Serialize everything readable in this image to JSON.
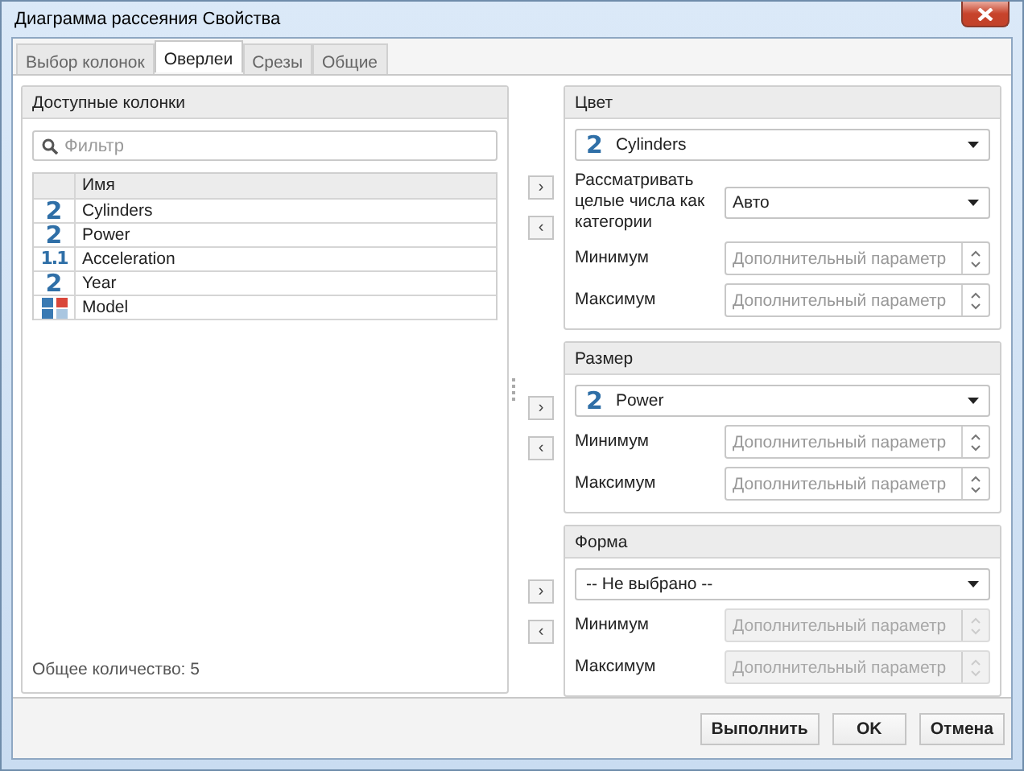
{
  "window": {
    "title": "Диаграмма рассеяния Свойства"
  },
  "tabs": [
    {
      "label": "Выбор колонок",
      "selected": false
    },
    {
      "label": "Оверлеи",
      "selected": true
    },
    {
      "label": "Срезы",
      "selected": false
    },
    {
      "label": "Общие",
      "selected": false
    }
  ],
  "columns_panel": {
    "title": "Доступные колонки",
    "search": {
      "placeholder": "Фильтр"
    },
    "table": {
      "columns": [
        "Имя"
      ],
      "rows": [
        {
          "kind": "integer",
          "icon": "2",
          "name": "Cylinders"
        },
        {
          "kind": "integer",
          "icon": "2",
          "name": "Power"
        },
        {
          "kind": "real",
          "icon": "1.1",
          "name": "Acceleration"
        },
        {
          "kind": "integer",
          "icon": "2",
          "name": "Year"
        },
        {
          "kind": "categorical",
          "name": "Model"
        }
      ]
    },
    "total": "Общее количество: 5"
  },
  "sections": [
    {
      "title": "Цвет",
      "move_buttons": [
        "›",
        "‹"
      ],
      "selector": {
        "kind": "integer",
        "icon": "2",
        "value": "Cylinders"
      },
      "option": {
        "label": "Рассматривать целые числа как категории",
        "value": "Авто"
      },
      "fields": [
        {
          "label": "Минимум",
          "placeholder": "Дополнительный параметр",
          "disabled": false
        },
        {
          "label": "Максимум",
          "placeholder": "Дополнительный параметр",
          "disabled": false
        }
      ]
    },
    {
      "title": "Размер",
      "move_buttons": [
        "›",
        "‹"
      ],
      "selector": {
        "kind": "integer",
        "icon": "2",
        "value": "Power"
      },
      "fields": [
        {
          "label": "Минимум",
          "placeholder": "Дополнительный параметр",
          "disabled": false
        },
        {
          "label": "Максимум",
          "placeholder": "Дополнительный параметр",
          "disabled": false
        }
      ]
    },
    {
      "title": "Форма",
      "move_buttons": [
        "›",
        "‹"
      ],
      "selector": {
        "kind": "none",
        "value": "-- Не выбрано --"
      },
      "fields": [
        {
          "label": "Минимум",
          "placeholder": "Дополнительный параметр",
          "disabled": true
        },
        {
          "label": "Максимум",
          "placeholder": "Дополнительный параметр",
          "disabled": true
        }
      ]
    }
  ],
  "buttons": [
    "Выполнить",
    "OK",
    "Отмена"
  ]
}
